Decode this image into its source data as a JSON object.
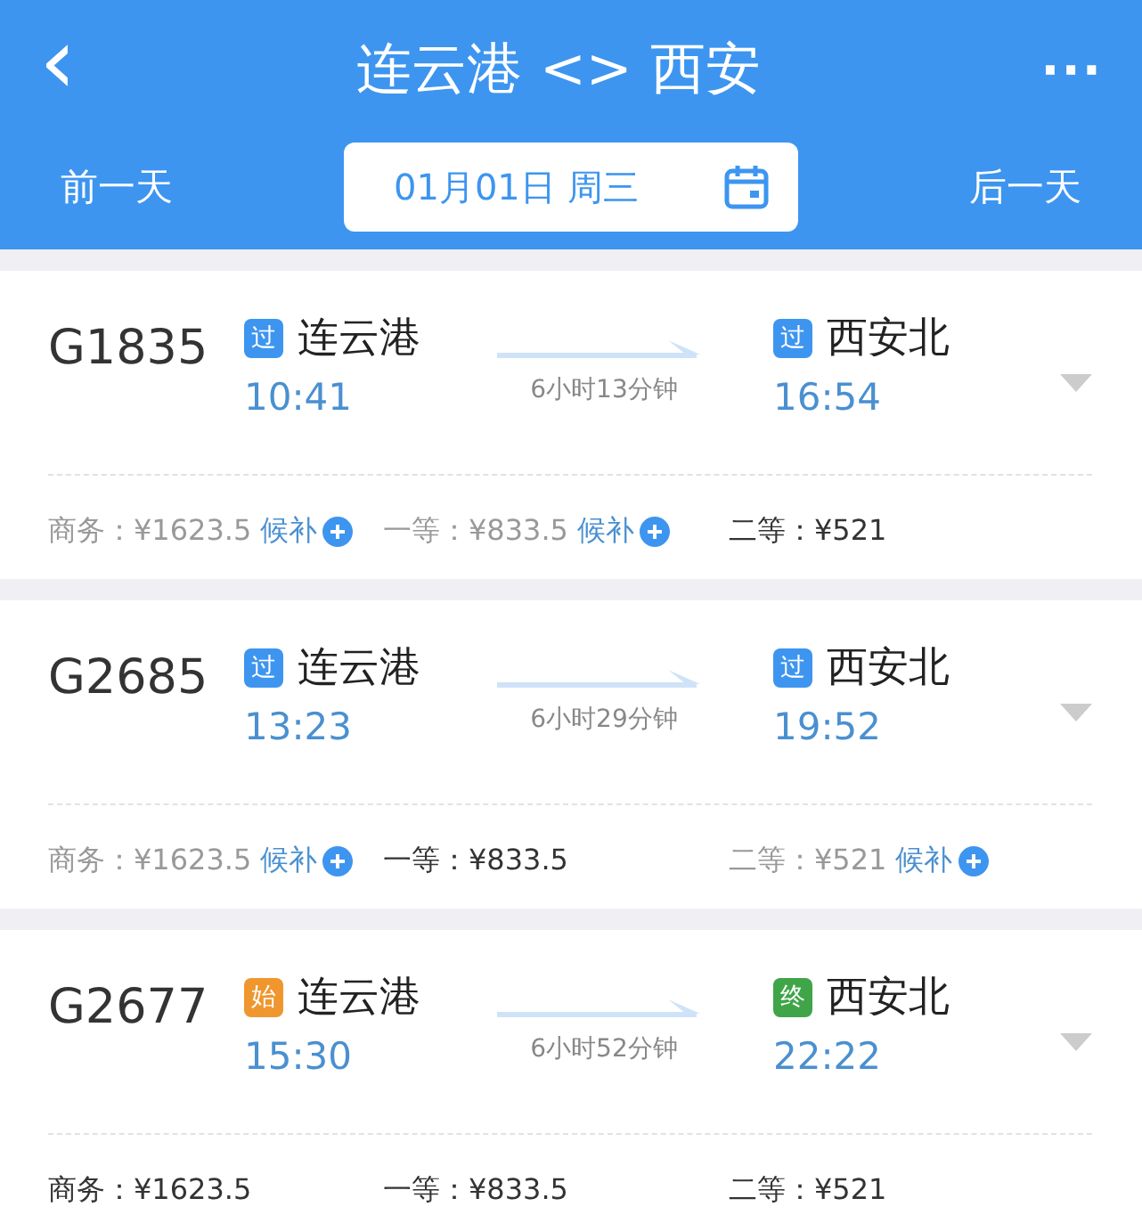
{
  "header": {
    "back": "‹",
    "title": "连云港 <> 西安",
    "more": "···",
    "prev_day": "前一天",
    "date": "01月01日 周三",
    "next_day": "后一天"
  },
  "trains": [
    {
      "number": "G1835",
      "from": {
        "badge": "过",
        "color": "#3d95f0",
        "station": "连云港",
        "time": "10:41"
      },
      "to": {
        "badge": "过",
        "color": "#3d95f0",
        "station": "西安北",
        "time": "16:54"
      },
      "duration": "6小时13分钟",
      "fares": [
        {
          "label": "商务：",
          "price": "¥1623.5",
          "available": false,
          "waitlist": "候补"
        },
        {
          "label": "一等：",
          "price": "¥833.5",
          "available": false,
          "waitlist": "候补"
        },
        {
          "label": "二等：",
          "price": "¥521",
          "available": true
        }
      ]
    },
    {
      "number": "G2685",
      "from": {
        "badge": "过",
        "color": "#3d95f0",
        "station": "连云港",
        "time": "13:23"
      },
      "to": {
        "badge": "过",
        "color": "#3d95f0",
        "station": "西安北",
        "time": "19:52"
      },
      "duration": "6小时29分钟",
      "fares": [
        {
          "label": "商务：",
          "price": "¥1623.5",
          "available": false,
          "waitlist": "候补"
        },
        {
          "label": "一等：",
          "price": "¥833.5",
          "available": true
        },
        {
          "label": "二等：",
          "price": "¥521",
          "available": false,
          "waitlist": "候补"
        }
      ]
    },
    {
      "number": "G2677",
      "from": {
        "badge": "始",
        "color": "#f0962e",
        "station": "连云港",
        "time": "15:30"
      },
      "to": {
        "badge": "终",
        "color": "#3fa548",
        "station": "西安北",
        "time": "22:22"
      },
      "duration": "6小时52分钟",
      "fares": [
        {
          "label": "商务：",
          "price": "¥1623.5",
          "available": true
        },
        {
          "label": "一等：",
          "price": "¥833.5",
          "available": true
        },
        {
          "label": "二等：",
          "price": "¥521",
          "available": true
        }
      ]
    }
  ]
}
